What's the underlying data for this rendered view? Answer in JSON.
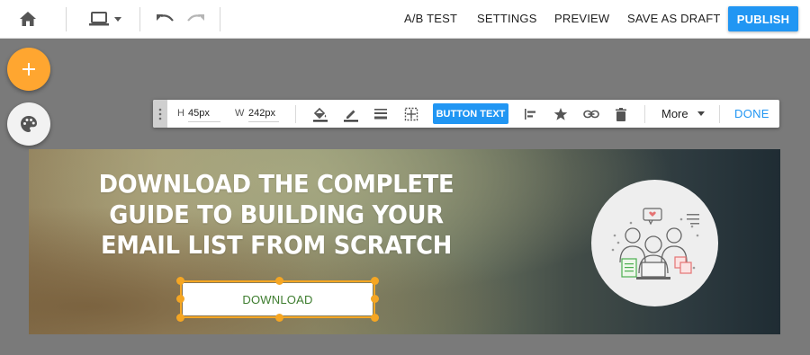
{
  "topbar": {
    "icons": {
      "home": "home-icon",
      "device": "laptop-icon",
      "device_dropdown": "caret-down-icon",
      "undo": "undo-icon",
      "redo": "redo-icon"
    },
    "nav": {
      "ab_test": "A/B TEST",
      "settings": "SETTINGS",
      "preview": "PREVIEW",
      "save_draft": "SAVE AS DRAFT"
    },
    "publish_label": "PUBLISH"
  },
  "side_actions": {
    "add_icon": "plus-icon",
    "palette_icon": "palette-icon"
  },
  "toolbar": {
    "height_label": "H",
    "height_value": "45px",
    "width_label": "W",
    "width_value": "242px",
    "button_text_label": "BUTTON TEXT",
    "more_label": "More",
    "done_label": "DONE",
    "icons": [
      "drag-handle-icon",
      "fill-color-icon",
      "border-color-icon",
      "border-style-icon",
      "spacing-icon",
      "align-left-icon",
      "star-icon",
      "link-icon",
      "delete-icon",
      "caret-down-icon"
    ]
  },
  "banner": {
    "headline_lines": [
      "DOWNLOAD THE COMPLETE",
      "GUIDE TO BUILDING YOUR",
      "EMAIL LIST FROM SCRATCH"
    ],
    "button_label": "DOWNLOAD",
    "illustration": "team-icon"
  },
  "colors": {
    "accent_blue": "#2196f3",
    "fab_orange": "#ffa630",
    "selection_orange": "#f5a623",
    "download_text": "#3e7d2f",
    "canvas_gray": "#7a7a7a"
  }
}
